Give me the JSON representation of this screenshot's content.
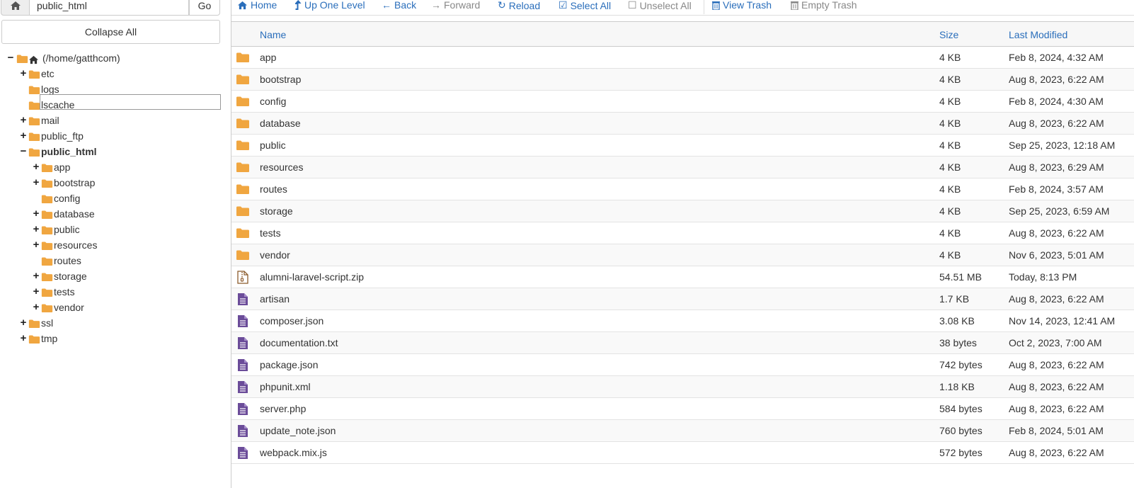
{
  "colors": {
    "folder": "#f0a640",
    "file": "#6b4c99",
    "link": "#2a6ebb",
    "zip": "#8b5a2b"
  },
  "pathbar": {
    "value": "public_html",
    "go_label": "Go"
  },
  "collapse_label": "Collapse All",
  "tree": [
    {
      "label": "(/home/gatthcom)",
      "level": 0,
      "toggle": "−",
      "icon": "home-icon"
    },
    {
      "label": "etc",
      "level": 1,
      "toggle": "+",
      "icon": "folder-icon"
    },
    {
      "label": "logs",
      "level": 1,
      "toggle": "",
      "icon": "folder-icon"
    },
    {
      "label": "lscache",
      "level": 1,
      "toggle": "",
      "icon": "folder-icon"
    },
    {
      "label": "mail",
      "level": 1,
      "toggle": "+",
      "icon": "folder-icon"
    },
    {
      "label": "public_ftp",
      "level": 1,
      "toggle": "+",
      "icon": "folder-icon"
    },
    {
      "label": "public_html",
      "level": 1,
      "toggle": "−",
      "icon": "folder-open-icon",
      "selected": true
    },
    {
      "label": "app",
      "level": 2,
      "toggle": "+",
      "icon": "folder-icon"
    },
    {
      "label": "bootstrap",
      "level": 2,
      "toggle": "+",
      "icon": "folder-icon"
    },
    {
      "label": "config",
      "level": 2,
      "toggle": "",
      "icon": "folder-icon"
    },
    {
      "label": "database",
      "level": 2,
      "toggle": "+",
      "icon": "folder-icon"
    },
    {
      "label": "public",
      "level": 2,
      "toggle": "+",
      "icon": "folder-icon"
    },
    {
      "label": "resources",
      "level": 2,
      "toggle": "+",
      "icon": "folder-icon"
    },
    {
      "label": "routes",
      "level": 2,
      "toggle": "",
      "icon": "folder-icon"
    },
    {
      "label": "storage",
      "level": 2,
      "toggle": "+",
      "icon": "folder-icon"
    },
    {
      "label": "tests",
      "level": 2,
      "toggle": "+",
      "icon": "folder-icon"
    },
    {
      "label": "vendor",
      "level": 2,
      "toggle": "+",
      "icon": "folder-icon"
    },
    {
      "label": "ssl",
      "level": 1,
      "toggle": "+",
      "icon": "folder-icon"
    },
    {
      "label": "tmp",
      "level": 1,
      "toggle": "+",
      "icon": "folder-icon"
    }
  ],
  "toolbar": {
    "home": "Home",
    "up": "Up One Level",
    "back": "Back",
    "forward": "Forward",
    "reload": "Reload",
    "select_all": "Select All",
    "unselect_all": "Unselect All",
    "view_trash": "View Trash",
    "empty_trash": "Empty Trash"
  },
  "table": {
    "headers": {
      "name": "Name",
      "size": "Size",
      "modified": "Last Modified"
    },
    "rows": [
      {
        "name": "app",
        "size": "4 KB",
        "modified": "Feb 8, 2024, 4:32 AM",
        "type": "folder"
      },
      {
        "name": "bootstrap",
        "size": "4 KB",
        "modified": "Aug 8, 2023, 6:22 AM",
        "type": "folder"
      },
      {
        "name": "config",
        "size": "4 KB",
        "modified": "Feb 8, 2024, 4:30 AM",
        "type": "folder"
      },
      {
        "name": "database",
        "size": "4 KB",
        "modified": "Aug 8, 2023, 6:22 AM",
        "type": "folder"
      },
      {
        "name": "public",
        "size": "4 KB",
        "modified": "Sep 25, 2023, 12:18 AM",
        "type": "folder"
      },
      {
        "name": "resources",
        "size": "4 KB",
        "modified": "Aug 8, 2023, 6:29 AM",
        "type": "folder"
      },
      {
        "name": "routes",
        "size": "4 KB",
        "modified": "Feb 8, 2024, 3:57 AM",
        "type": "folder"
      },
      {
        "name": "storage",
        "size": "4 KB",
        "modified": "Sep 25, 2023, 6:59 AM",
        "type": "folder"
      },
      {
        "name": "tests",
        "size": "4 KB",
        "modified": "Aug 8, 2023, 6:22 AM",
        "type": "folder"
      },
      {
        "name": "vendor",
        "size": "4 KB",
        "modified": "Nov 6, 2023, 5:01 AM",
        "type": "folder"
      },
      {
        "name": "alumni-laravel-script.zip",
        "size": "54.51 MB",
        "modified": "Today, 8:13 PM",
        "type": "zip"
      },
      {
        "name": "artisan",
        "size": "1.7 KB",
        "modified": "Aug 8, 2023, 6:22 AM",
        "type": "file"
      },
      {
        "name": "composer.json",
        "size": "3.08 KB",
        "modified": "Nov 14, 2023, 12:41 AM",
        "type": "file"
      },
      {
        "name": "documentation.txt",
        "size": "38 bytes",
        "modified": "Oct 2, 2023, 7:00 AM",
        "type": "file"
      },
      {
        "name": "package.json",
        "size": "742 bytes",
        "modified": "Aug 8, 2023, 6:22 AM",
        "type": "file"
      },
      {
        "name": "phpunit.xml",
        "size": "1.18 KB",
        "modified": "Aug 8, 2023, 6:22 AM",
        "type": "file"
      },
      {
        "name": "server.php",
        "size": "584 bytes",
        "modified": "Aug 8, 2023, 6:22 AM",
        "type": "file"
      },
      {
        "name": "update_note.json",
        "size": "760 bytes",
        "modified": "Feb 8, 2024, 5:01 AM",
        "type": "file"
      },
      {
        "name": "webpack.mix.js",
        "size": "572 bytes",
        "modified": "Aug 8, 2023, 6:22 AM",
        "type": "file"
      }
    ]
  }
}
